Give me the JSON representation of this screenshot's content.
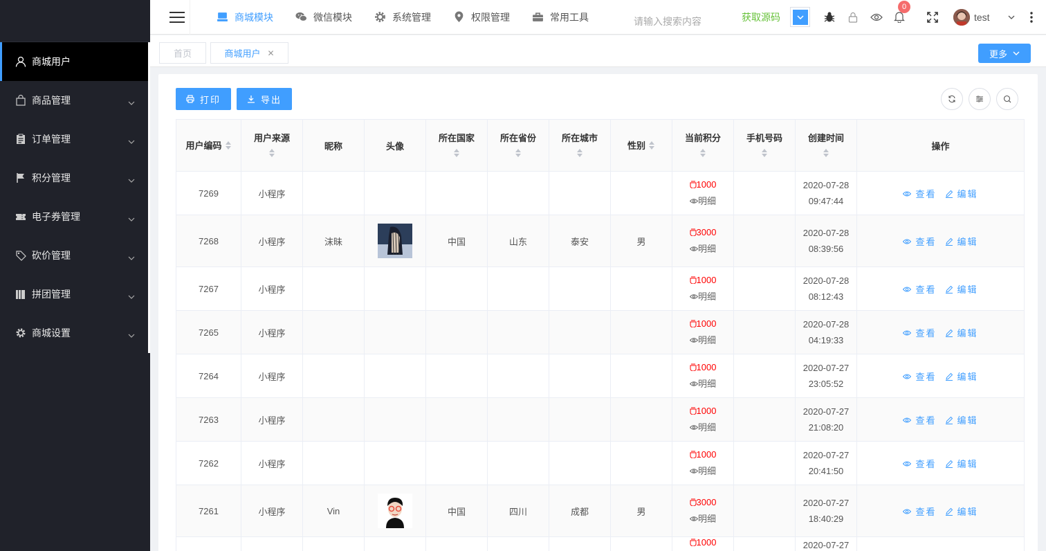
{
  "header": {
    "nav": [
      {
        "label": "商城模块",
        "icon": "monitor-icon",
        "active": true
      },
      {
        "label": "微信模块",
        "icon": "wechat-icon",
        "active": false
      },
      {
        "label": "系统管理",
        "icon": "gear-icon",
        "active": false
      },
      {
        "label": "权限管理",
        "icon": "location-shield-icon",
        "active": false
      },
      {
        "label": "常用工具",
        "icon": "toolbox-icon",
        "active": false
      }
    ],
    "search_placeholder": "请输入搜索内容",
    "get_source": "获取源码",
    "notification_count": "0",
    "username": "test"
  },
  "sidebar": {
    "items": [
      {
        "label": "商城用户",
        "icon": "user-icon",
        "active": true
      },
      {
        "label": "商品管理",
        "icon": "shopping-bag-icon"
      },
      {
        "label": "订单管理",
        "icon": "clipboard-icon"
      },
      {
        "label": "积分管理",
        "icon": "flag-icon"
      },
      {
        "label": "电子券管理",
        "icon": "ticket-icon"
      },
      {
        "label": "砍价管理",
        "icon": "tag-icon"
      },
      {
        "label": "拼团管理",
        "icon": "books-icon"
      },
      {
        "label": "商城设置",
        "icon": "gear-icon"
      }
    ]
  },
  "tabs": {
    "home": "首页",
    "current": "商城用户",
    "more": "更多"
  },
  "toolbar": {
    "print": "打印",
    "export": "导出"
  },
  "table": {
    "columns": [
      "用户编码",
      "用户来源",
      "昵称",
      "头像",
      "所在国家",
      "所在省份",
      "所在城市",
      "性别",
      "当前积分",
      "手机号码",
      "创建时间",
      "操作"
    ],
    "detail_label": "明细",
    "view_label": "查看",
    "edit_label": "编辑",
    "rows": [
      {
        "id": "7269",
        "source": "小程序",
        "nickname": "",
        "avatar": "",
        "country": "",
        "province": "",
        "city": "",
        "gender": "",
        "points": "1000",
        "phone": "",
        "date": "2020-07-28",
        "time": "09:47:44"
      },
      {
        "id": "7268",
        "source": "小程序",
        "nickname": "沫昧",
        "avatar": "photo",
        "country": "中国",
        "province": "山东",
        "city": "泰安",
        "gender": "男",
        "points": "3000",
        "phone": "",
        "date": "2020-07-28",
        "time": "08:39:56"
      },
      {
        "id": "7267",
        "source": "小程序",
        "nickname": "",
        "avatar": "",
        "country": "",
        "province": "",
        "city": "",
        "gender": "",
        "points": "1000",
        "phone": "",
        "date": "2020-07-28",
        "time": "08:12:43"
      },
      {
        "id": "7265",
        "source": "小程序",
        "nickname": "",
        "avatar": "",
        "country": "",
        "province": "",
        "city": "",
        "gender": "",
        "points": "1000",
        "phone": "",
        "date": "2020-07-28",
        "time": "04:19:33"
      },
      {
        "id": "7264",
        "source": "小程序",
        "nickname": "",
        "avatar": "",
        "country": "",
        "province": "",
        "city": "",
        "gender": "",
        "points": "1000",
        "phone": "",
        "date": "2020-07-27",
        "time": "23:05:52"
      },
      {
        "id": "7263",
        "source": "小程序",
        "nickname": "",
        "avatar": "",
        "country": "",
        "province": "",
        "city": "",
        "gender": "",
        "points": "1000",
        "phone": "",
        "date": "2020-07-27",
        "time": "21:08:20"
      },
      {
        "id": "7262",
        "source": "小程序",
        "nickname": "",
        "avatar": "",
        "country": "",
        "province": "",
        "city": "",
        "gender": "",
        "points": "1000",
        "phone": "",
        "date": "2020-07-27",
        "time": "20:41:50"
      },
      {
        "id": "7261",
        "source": "小程序",
        "nickname": "Vin",
        "avatar": "cartoon",
        "country": "中国",
        "province": "四川",
        "city": "成都",
        "gender": "男",
        "points": "3000",
        "phone": "",
        "date": "2020-07-27",
        "time": "18:40:29"
      },
      {
        "id": "",
        "source": "",
        "nickname": "",
        "avatar": "",
        "country": "",
        "province": "",
        "city": "",
        "gender": "",
        "points": "1000",
        "phone": "",
        "date": "2020-07-27",
        "time": ""
      }
    ]
  }
}
